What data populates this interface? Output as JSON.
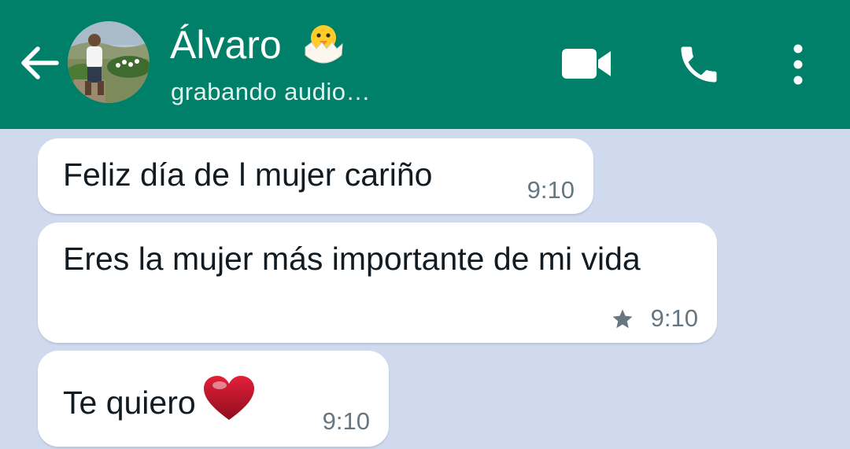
{
  "header": {
    "contact_name": "Álvaro",
    "status": "grabando audio…",
    "bg_color": "#008069",
    "name_emoji": "hatching-chick-icon",
    "actions": [
      "video-call-icon",
      "voice-call-icon",
      "more-options-icon"
    ]
  },
  "messages": [
    {
      "text": "Feliz día de l mujer cariño",
      "time": "9:10",
      "starred": false
    },
    {
      "text": "Eres la mujer más importante de mi vida",
      "time": "9:10",
      "starred": true
    },
    {
      "text": "Te quiero",
      "emoji": "red-heart-icon",
      "time": "9:10",
      "starred": false
    }
  ],
  "colors": {
    "chat_bg": "#cfdaef",
    "bubble": "#ffffff",
    "text": "#111b21",
    "meta": "#667781"
  }
}
